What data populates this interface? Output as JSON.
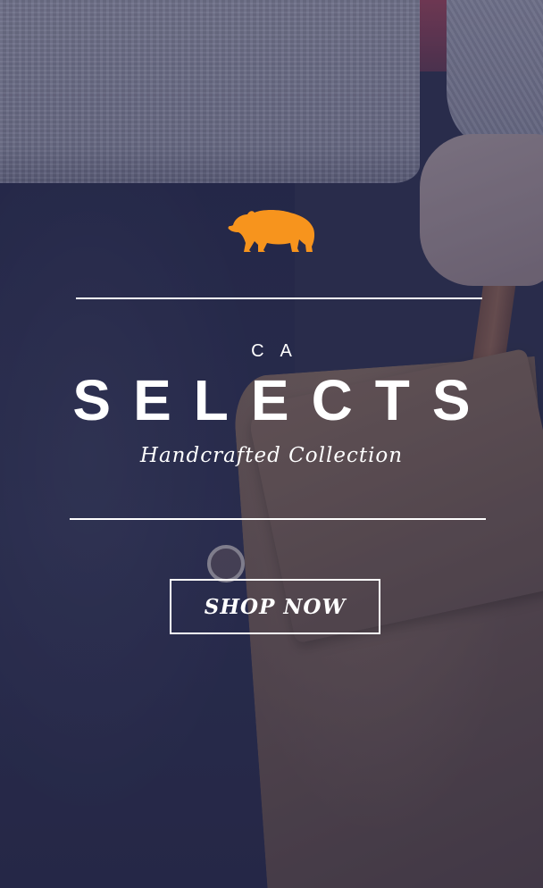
{
  "hero": {
    "eyebrow": "CA",
    "title": "SELECTS",
    "subtitle": "Handcrafted Collection",
    "cta_label": "SHOP NOW",
    "logo_icon": "bear-icon"
  },
  "colors": {
    "accent": "#F7941D",
    "text": "#FFFFFF",
    "overlay": "#2A2D4A"
  }
}
